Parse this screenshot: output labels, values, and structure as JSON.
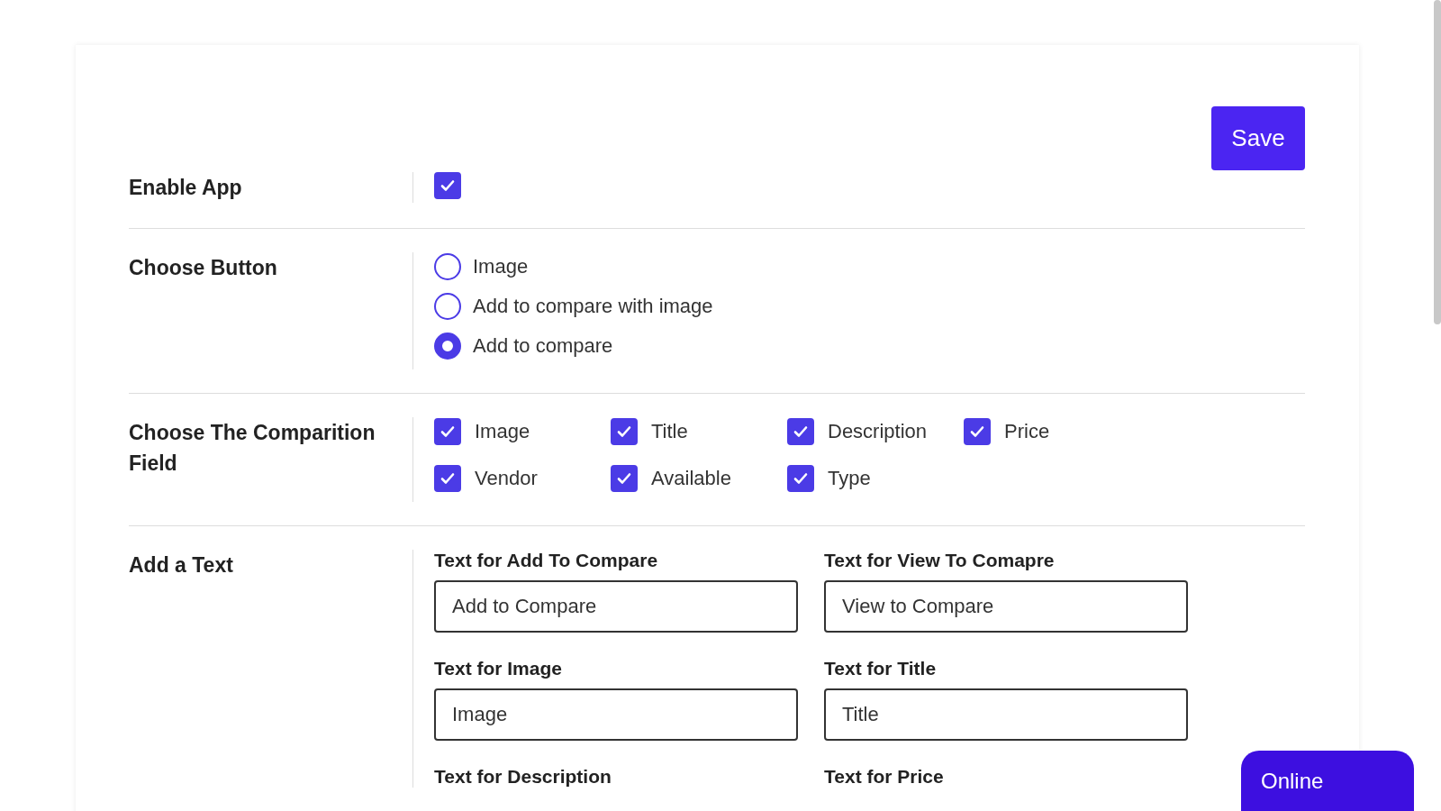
{
  "save_button": "Save",
  "sections": [
    {
      "kind": "checkbox",
      "label": "Enable App",
      "checked": true
    },
    {
      "kind": "radio",
      "label": "Choose Button",
      "options": [
        {
          "label": "Image",
          "selected": false
        },
        {
          "label": "Add to compare with image",
          "selected": false
        },
        {
          "label": "Add to compare",
          "selected": true
        }
      ]
    },
    {
      "kind": "checkgrid",
      "label": "Choose The Comparition Field",
      "options": [
        {
          "label": "Image",
          "checked": true
        },
        {
          "label": "Title",
          "checked": true
        },
        {
          "label": "Description",
          "checked": true
        },
        {
          "label": "Price",
          "checked": true
        },
        {
          "label": "Vendor",
          "checked": true
        },
        {
          "label": "Available",
          "checked": true
        },
        {
          "label": "Type",
          "checked": true
        }
      ]
    },
    {
      "kind": "texts",
      "label": "Add a Text",
      "fields": [
        {
          "label": "Text for Add To Compare",
          "value": "Add to Compare"
        },
        {
          "label": "Text for View To Comapre",
          "value": "View to Compare"
        },
        {
          "label": "Text for Image",
          "value": "Image"
        },
        {
          "label": "Text for Title",
          "value": "Title"
        },
        {
          "label": "Text for Description"
        },
        {
          "label": "Text for Price"
        }
      ]
    }
  ],
  "chat_button": "Online"
}
